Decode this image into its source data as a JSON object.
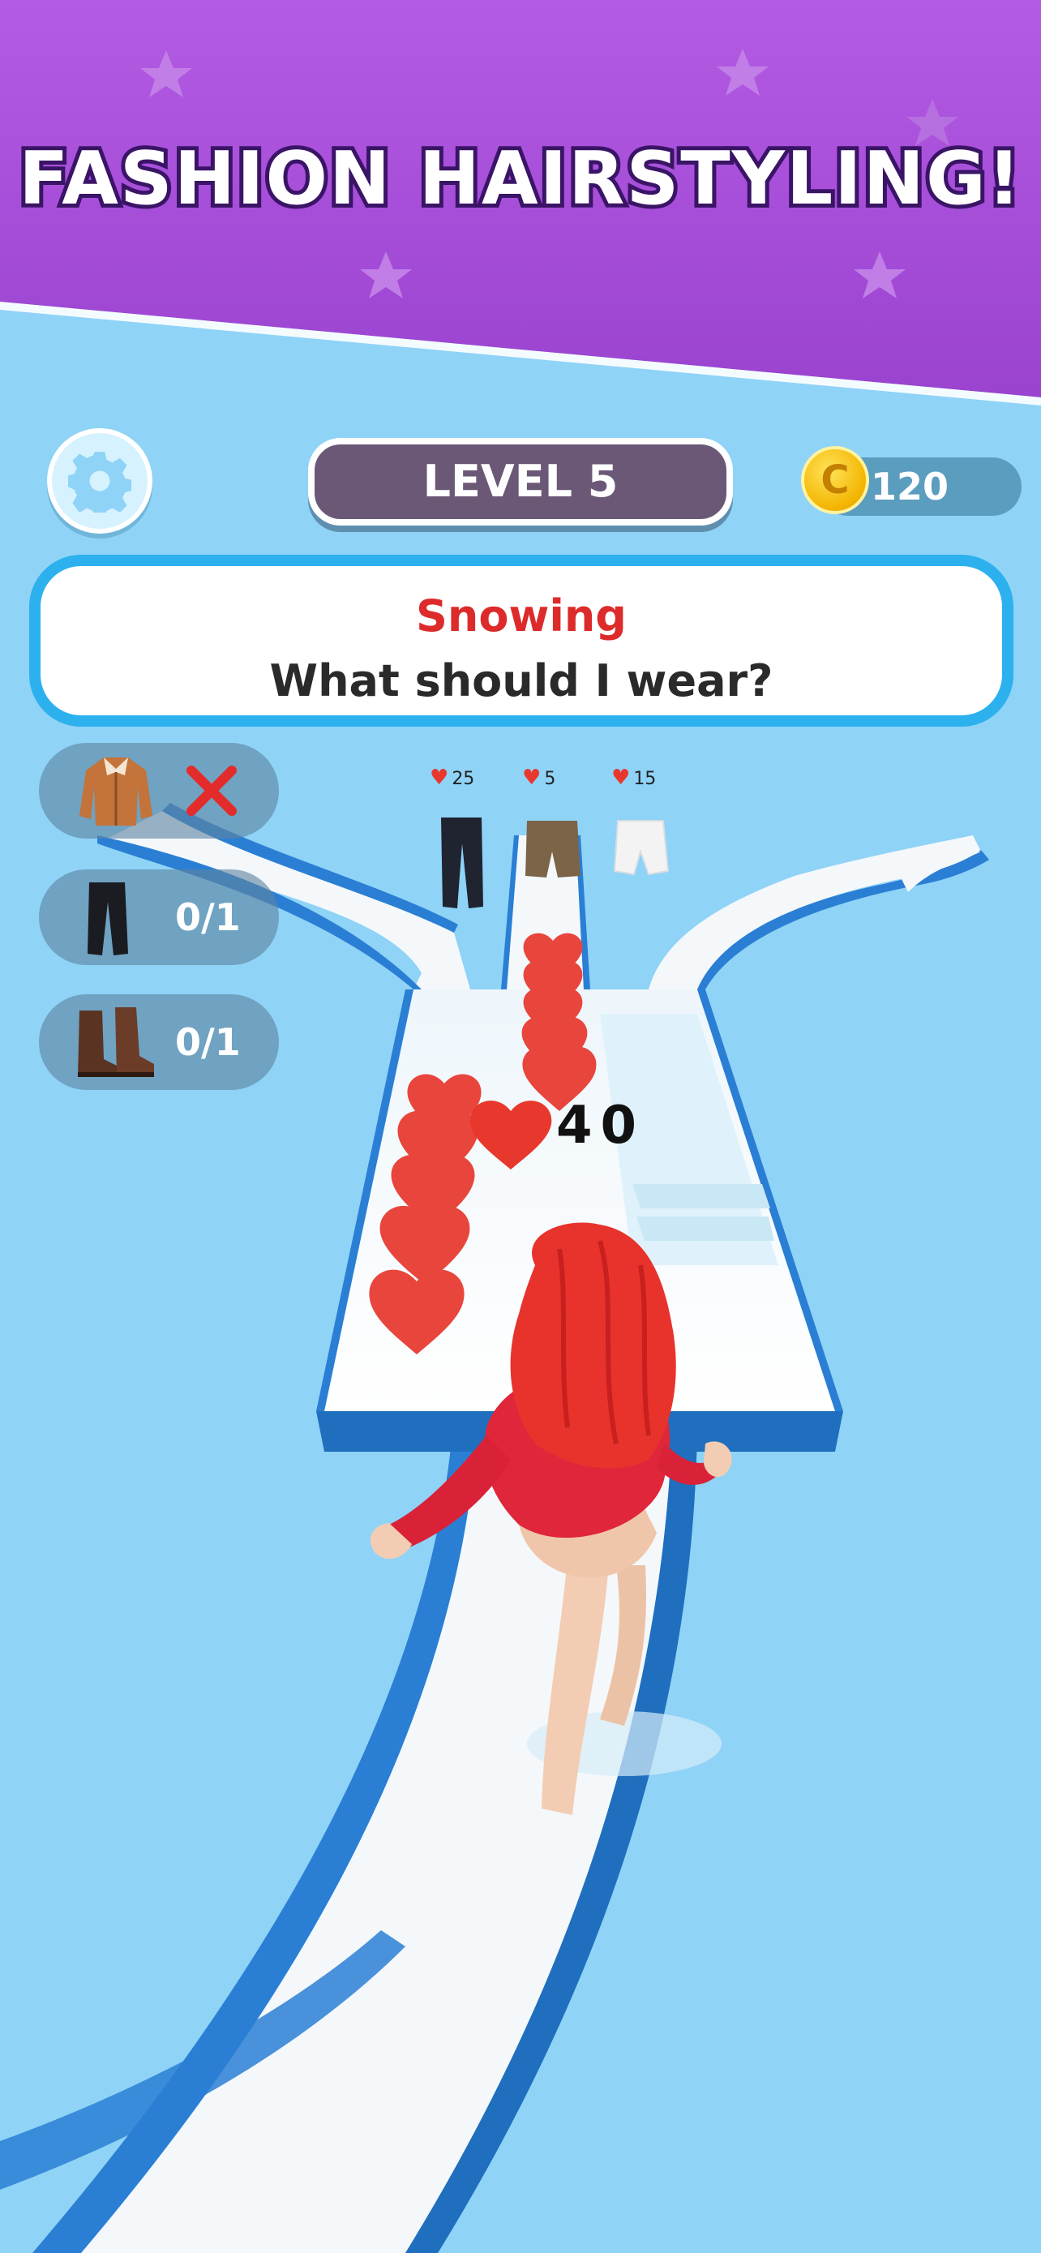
{
  "banner": {
    "title": "FASHION HAIRSTYLING!"
  },
  "hud": {
    "level_label": "LEVEL 5",
    "coins": "120",
    "coin_symbol": "C",
    "settings_icon": "gear-icon"
  },
  "prompt": {
    "weather": "Snowing",
    "question": "What should I wear?"
  },
  "outfit_slots": [
    {
      "item": "coat",
      "icon": "coat-icon",
      "status": "",
      "status_icon": "x-mark-icon"
    },
    {
      "item": "pants",
      "icon": "pants-icon",
      "status": "0/1"
    },
    {
      "item": "boots",
      "icon": "boots-icon",
      "status": "0/1"
    }
  ],
  "gate_items": [
    {
      "item": "black pants",
      "cost": "25"
    },
    {
      "item": "brown shorts",
      "cost": "5"
    },
    {
      "item": "white shorts",
      "cost": "15"
    }
  ],
  "score": {
    "hearts": "40"
  },
  "colors": {
    "banner": "#a64fd6",
    "sky": "#8fd3f7",
    "track_edge": "#2a7fd4",
    "track_surface": "#f4f8fb",
    "heart": "#e8453c",
    "prompt_border": "#2cb1ee",
    "weather_text": "#dc2b2a",
    "level_pill": "#6b5876",
    "coin": "#f3b400"
  }
}
